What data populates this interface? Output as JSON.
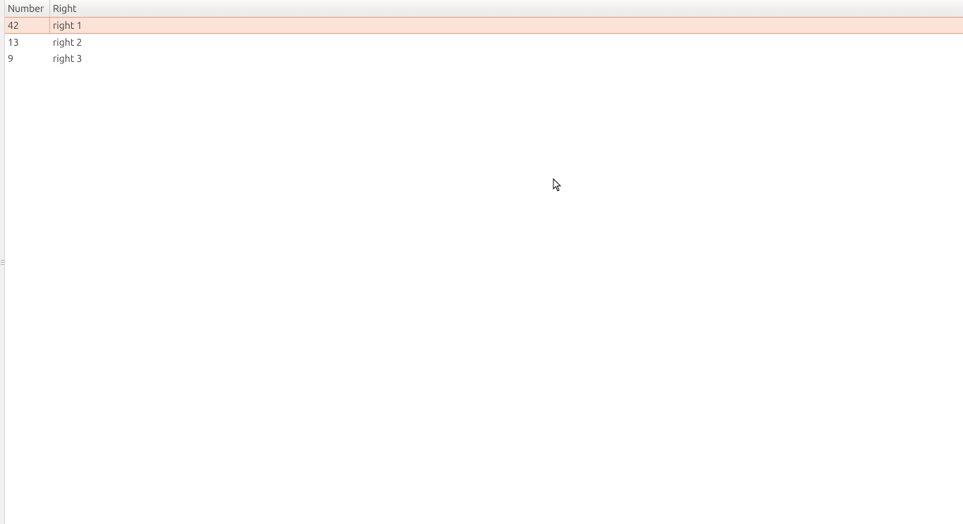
{
  "table": {
    "columns": {
      "number": "Number",
      "right": "Right"
    },
    "rows": [
      {
        "number": "42",
        "right": "right 1",
        "selected": true
      },
      {
        "number": "13",
        "right": "right 2",
        "selected": false
      },
      {
        "number": "9",
        "right": "right 3",
        "selected": false
      }
    ]
  }
}
